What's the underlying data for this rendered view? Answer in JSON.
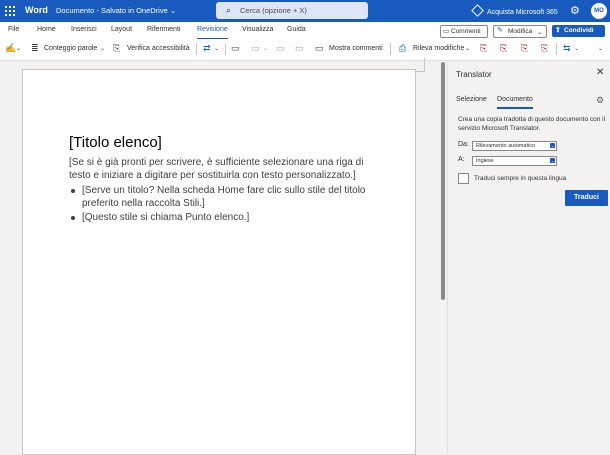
{
  "topbar": {
    "app_name": "Word",
    "doc_title": "Documento",
    "doc_status": "Salvato in OneDrive",
    "search_placeholder": "Cerca (opzione + X)",
    "ms365_label": "Acquista Microsoft 365",
    "avatar_initials": "MO"
  },
  "ribbon": {
    "tabs": [
      "File",
      "Home",
      "Inserisci",
      "Layout",
      "Riferimenti",
      "Revisione",
      "Visualizza",
      "Guida"
    ],
    "active_tab": "Revisione",
    "comments_label": "Commenti",
    "edit_label": "Modifica",
    "share_label": "Condividi"
  },
  "toolbar": {
    "word_count": "Conteggio parole",
    "accessibility": "Verifica accessibilità",
    "show_comments": "Mostra commenti",
    "track_changes": "Rileva modifiche"
  },
  "document": {
    "title": "[Titolo elenco]",
    "paragraph": "[Se si è già pronti per scrivere, è sufficiente selezionare una riga di testo e iniziare a digitare per sostituirla con testo personalizzato.]",
    "bullets": [
      "[Serve un titolo? Nella scheda Home fare clic sullo stile del titolo preferito nella raccolta Stili.]",
      "[Questo stile si chiama Punto elenco.]"
    ]
  },
  "translator": {
    "title": "Translator",
    "tabs": [
      "Selezione",
      "Documento"
    ],
    "active_tab": "Documento",
    "description": "Crea una copia tradotta di questo documento con il servizio Microsoft Translator.",
    "from_label": "Da:",
    "from_value": "Rilevamento automatico",
    "to_label": "A:",
    "to_value": "Inglese",
    "always_translate": "Traduci sempre in questa lingua",
    "translate_button": "Traduci"
  },
  "colors": {
    "brand": "#185abd",
    "background": "#f3f2f1"
  }
}
